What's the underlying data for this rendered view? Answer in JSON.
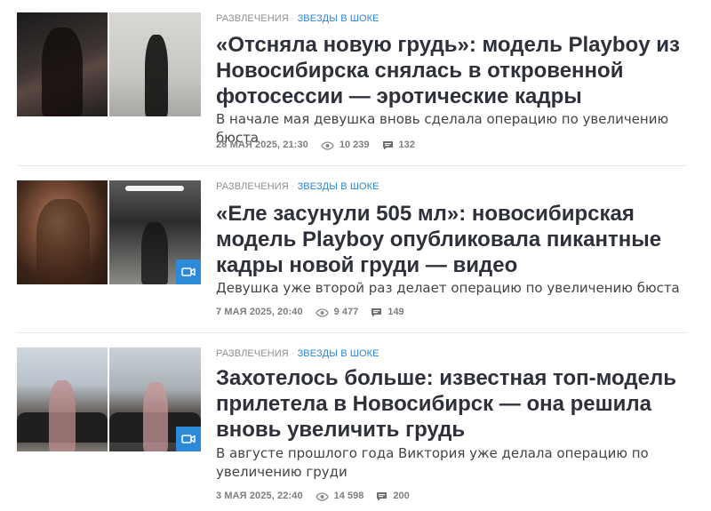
{
  "articles": [
    {
      "rubric": "Развлечения",
      "tag": "Звезды в шоке",
      "title": "«Отсняла новую грудь»: модель Playboy из Новосибирска снялась в откровенной фотосессии — эротические кадры",
      "lead": "В начале мая девушка вновь сделала операцию по увеличению бюста",
      "date": "28 мая 2025, 21:30",
      "views": "10 239",
      "comments": "132",
      "has_video": false
    },
    {
      "rubric": "Развлечения",
      "tag": "Звезды в шоке",
      "title": "«Еле засунули 505 мл»: новосибирская модель Playboy опубликовала пикантные кадры новой груди — видео",
      "lead": "Девушка уже второй раз делает операцию по увеличению бюста",
      "date": "7 мая 2025, 20:40",
      "views": "9 477",
      "comments": "149",
      "has_video": true
    },
    {
      "rubric": "Развлечения",
      "tag": "Звезды в шоке",
      "title": "Захотелось больше: известная топ-модель прилетела в Новосибирск — она решила вновь увеличить грудь",
      "lead": "В августе прошлого года Виктория уже делала операцию по увеличению груди",
      "date": "3 мая 2025, 22:40",
      "views": "14 598",
      "comments": "200",
      "has_video": true
    }
  ],
  "icons": {
    "views": "eye-icon",
    "comments": "comment-icon",
    "video": "video-camera-icon"
  },
  "colors": {
    "tag": "#2f85d3",
    "title": "#2e313b",
    "video_badge": "#2c8ad8",
    "meta": "#7d7d7d"
  }
}
